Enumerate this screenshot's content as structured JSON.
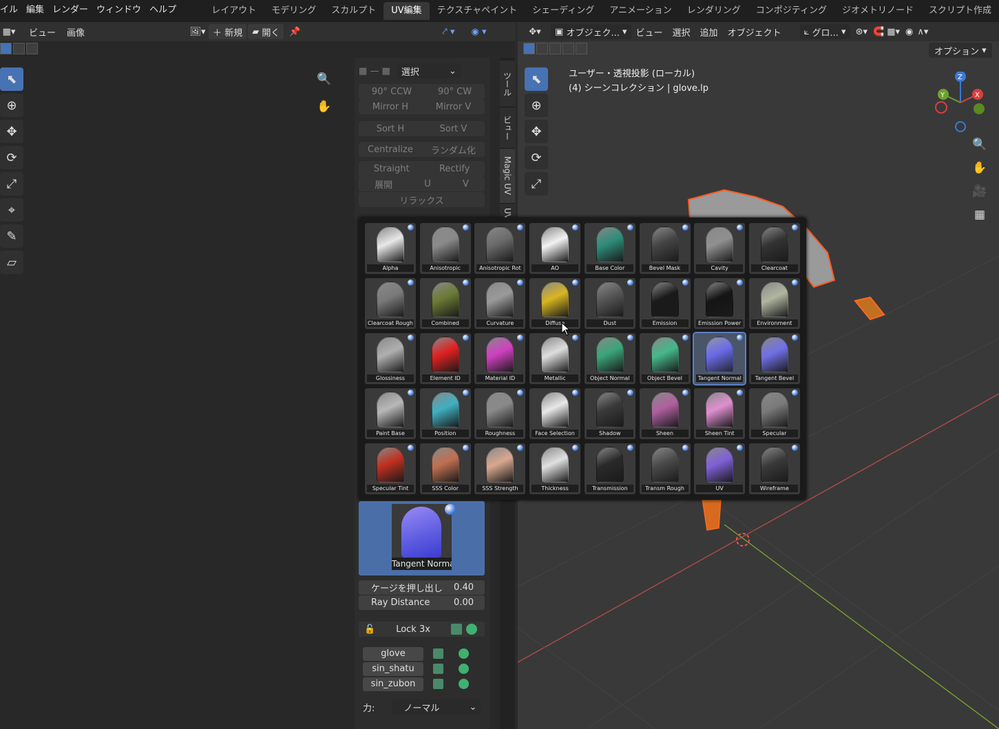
{
  "menus": [
    "イル",
    "編集",
    "レンダー",
    "ウィンドウ",
    "ヘルプ"
  ],
  "workspaces": [
    "レイアウト",
    "モデリング",
    "スカルプト",
    "UV編集",
    "テクスチャペイント",
    "シェーディング",
    "アニメーション",
    "レンダリング",
    "コンポジティング",
    "ジオメトリノード",
    "スクリプト作成"
  ],
  "active_workspace": "UV編集",
  "uv_header": {
    "view": "ビュー",
    "image": "画像",
    "new": "新規",
    "open": "開く"
  },
  "magic_uv": {
    "select_label": "選択",
    "rows": [
      [
        "90° CCW",
        "90° CW"
      ],
      [
        "Mirror H",
        "Mirror V"
      ],
      [
        "Sort H",
        "Sort V"
      ],
      [
        "Centralize",
        "ランダム化"
      ],
      [
        "Straight",
        "Rectify"
      ],
      [
        "展開",
        "U",
        "V"
      ],
      [
        "リラックス"
      ]
    ]
  },
  "tabs": [
    "ツール",
    "ビュー",
    "Magic UV",
    "UV"
  ],
  "viewport_header": {
    "mode": "オブジェク...",
    "view": "ビュー",
    "select": "選択",
    "add": "追加",
    "object": "オブジェクト",
    "transform": "グロ...",
    "options": "オプション"
  },
  "viewport_info": {
    "line1": "ユーザー・透視投影 (ローカル)",
    "line2": "(4) シーンコレクション | glove.lp"
  },
  "gizmo": {
    "x": "X",
    "y": "Y",
    "z": "Z"
  },
  "bake_maps": [
    {
      "label": "Alpha",
      "color": "#e8e8e8"
    },
    {
      "label": "Anisotropic",
      "color": "#8a8a8a"
    },
    {
      "label": "Anisotropic Rot",
      "color": "#6a6a6a"
    },
    {
      "label": "AO",
      "color": "#f2f2f2"
    },
    {
      "label": "Base Color",
      "color": "#2e8c7a"
    },
    {
      "label": "Bevel Mask",
      "color": "#444444"
    },
    {
      "label": "Cavity",
      "color": "#909090"
    },
    {
      "label": "Clearcoat",
      "color": "#333333"
    },
    {
      "label": "Clearcoat Rough",
      "color": "#7a7a7a"
    },
    {
      "label": "Combined",
      "color": "#6b7a35"
    },
    {
      "label": "Curvature",
      "color": "#9a9a9a"
    },
    {
      "label": "Diffuse",
      "color": "#d8b520"
    },
    {
      "label": "Dust",
      "color": "#555555"
    },
    {
      "label": "Emission",
      "color": "#1a1a1a"
    },
    {
      "label": "Emission Power",
      "color": "#151515"
    },
    {
      "label": "Environment",
      "color": "#b0b6a0"
    },
    {
      "label": "Glossiness",
      "color": "#b0b0b0"
    },
    {
      "label": "Element ID",
      "color": "#e02020"
    },
    {
      "label": "Material ID",
      "color": "#d040c0"
    },
    {
      "label": "Metallic",
      "color": "#dedede"
    },
    {
      "label": "Object Normal",
      "color": "#3aa57a"
    },
    {
      "label": "Object Bevel",
      "color": "#45b88a"
    },
    {
      "label": "Tangent Normal",
      "color": "#6a6ae8"
    },
    {
      "label": "Tangent Bevel",
      "color": "#7070e8"
    },
    {
      "label": "Paint Base",
      "color": "#b8b8b8"
    },
    {
      "label": "Position",
      "color": "#40b0c0"
    },
    {
      "label": "Roughness",
      "color": "#8a8a8a"
    },
    {
      "label": "Face Selection",
      "color": "#e8e8e8"
    },
    {
      "label": "Shadow",
      "color": "#3a3a3a"
    },
    {
      "label": "Sheen",
      "color": "#b060a0"
    },
    {
      "label": "Sheen Tint",
      "color": "#e090d0"
    },
    {
      "label": "Specular",
      "color": "#7a7a7a"
    },
    {
      "label": "Specular Tint",
      "color": "#c03020"
    },
    {
      "label": "SSS Color",
      "color": "#c07050"
    },
    {
      "label": "SSS Strength",
      "color": "#d8a890"
    },
    {
      "label": "Thickness",
      "color": "#e0e0e0"
    },
    {
      "label": "Transmission",
      "color": "#2a2a2a"
    },
    {
      "label": "Transm Rough",
      "color": "#4a4a4a"
    },
    {
      "label": "UV",
      "color": "#8060d8"
    },
    {
      "label": "Wireframe",
      "color": "#3a3a3a"
    }
  ],
  "selected_map": "Tangent Normal",
  "props": [
    {
      "label": "ケージを押し出し",
      "value": "0.40"
    },
    {
      "label": "Ray Distance",
      "value": "0.00"
    }
  ],
  "lock_label": "Lock 3x",
  "objects": [
    "glove",
    "sin_shatu",
    "sin_zubon"
  ],
  "force_label": "力:",
  "force_value": "ノーマル"
}
